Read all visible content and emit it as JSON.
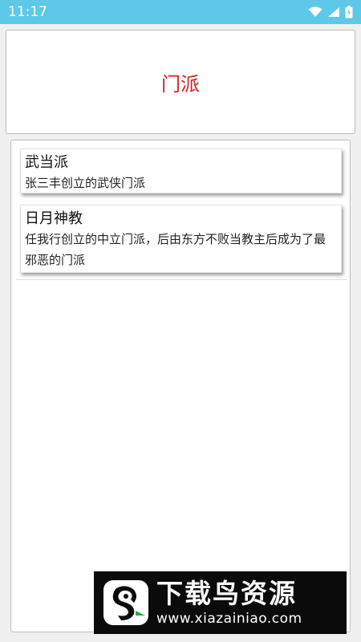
{
  "status_bar": {
    "time": "11:17",
    "icons": [
      "wifi-icon",
      "signal-icon",
      "battery-icon"
    ],
    "color": "#5ec8e8"
  },
  "header": {
    "title": "门派",
    "title_color": "#d81e1e"
  },
  "sects": [
    {
      "name": "武当派",
      "description": "张三丰创立的武侠门派"
    },
    {
      "name": "日月神教",
      "description": "任我行创立的中立门派，后由东方不败当教主后成为了最邪恶的门派"
    }
  ],
  "watermark": {
    "title": "下载鸟资源",
    "url": "www.xiazainiao.com"
  }
}
